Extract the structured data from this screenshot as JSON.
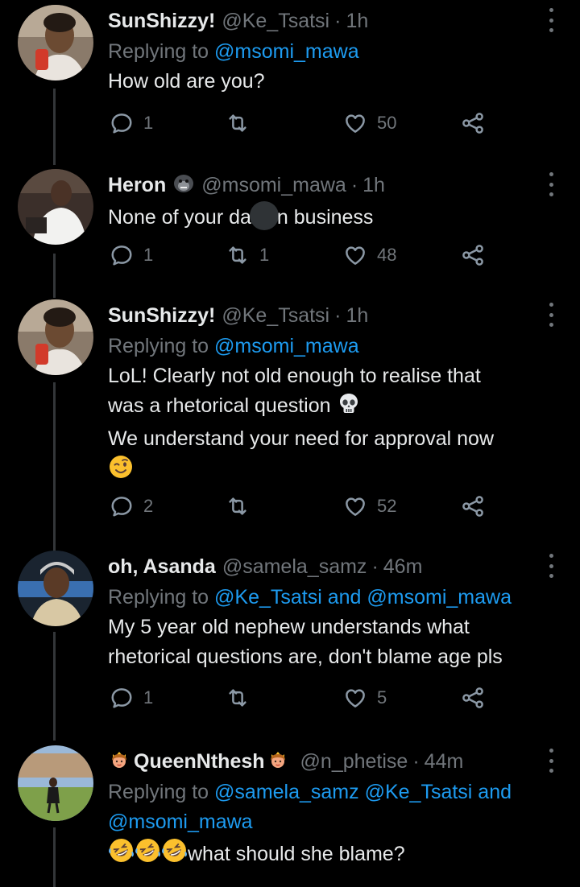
{
  "tweets": [
    {
      "name": "SunShizzy!",
      "handle": "@Ke_Tsatsi",
      "time": "1h",
      "reply_prefix": "Replying to",
      "reply_to": "@msomi_mawa",
      "lines": [
        "How old are you?"
      ],
      "replies": "1",
      "retweets": "",
      "likes": "50"
    },
    {
      "name": "Heron",
      "badge_icon": "gorilla-emoji",
      "handle": "@msomi_mawa",
      "time": "1h",
      "text_before": "None of your da",
      "text_after": "n business",
      "replies": "1",
      "retweets": "1",
      "likes": "48"
    },
    {
      "name": "SunShizzy!",
      "handle": "@Ke_Tsatsi",
      "time": "1h",
      "reply_prefix": "Replying to",
      "reply_to": "@msomi_mawa",
      "lines": [
        "LoL! Clearly not old enough to realise that",
        "was a rhetorical question",
        "We understand your need for approval now"
      ],
      "emoji_1": "skull-emoji",
      "emoji_2": "winking-face-emoji",
      "replies": "2",
      "retweets": "",
      "likes": "52"
    },
    {
      "name": "oh, Asanda",
      "handle": "@samela_samz",
      "time": "46m",
      "reply_prefix": "Replying to",
      "reply_to": "@Ke_Tsatsi and @msomi_mawa",
      "lines": [
        "My 5 year old nephew understands what",
        "rhetorical questions are, don't blame age pls"
      ],
      "replies": "1",
      "retweets": "",
      "likes": "5"
    },
    {
      "name": "QueenNthesh",
      "name_emoji": "princess-emoji",
      "handle": "@n_phetise",
      "time": "44m",
      "reply_prefix": "Replying to",
      "reply_line1": "@samela_samz @Ke_Tsatsi and",
      "reply_line2": "@msomi_mawa",
      "text": "what should she blame?",
      "text_emoji": "rolling-on-floor-laughing-emoji"
    }
  ],
  "separator": "·",
  "colors": {
    "background": "#000000",
    "text": "#e7e9ea",
    "muted": "#71767b",
    "accent": "#1d9bf0"
  }
}
